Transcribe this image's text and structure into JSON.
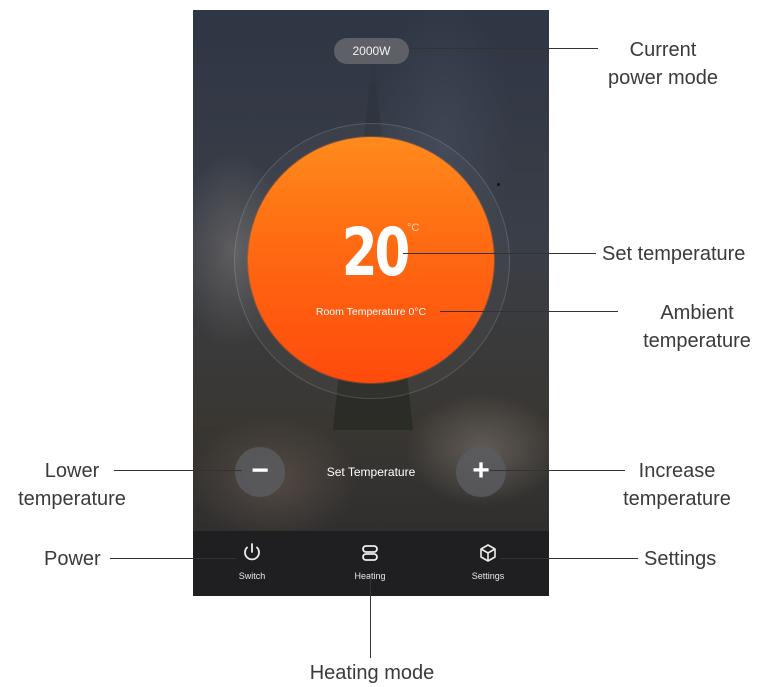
{
  "screen": {
    "power_mode": "2000W",
    "set_temperature": "20",
    "unit": "°C",
    "room_temperature": "Room Temperature 0°C",
    "minus_symbol": "−",
    "plus_symbol": "+",
    "set_label": "Set Temperature"
  },
  "tabs": [
    {
      "label": "Switch",
      "icon": "power-icon"
    },
    {
      "label": "Heating",
      "icon": "heating-mode-icon"
    },
    {
      "label": "Settings",
      "icon": "settings-cube-icon"
    }
  ],
  "annotations": {
    "current_power_mode": [
      "Current",
      "power mode"
    ],
    "set_temperature": "Set temperature",
    "ambient_temperature": [
      "Ambient",
      "temperature"
    ],
    "lower_temperature": [
      "Lower",
      "temperature"
    ],
    "increase_temperature": [
      "Increase",
      "temperature"
    ],
    "power": "Power",
    "settings": "Settings",
    "heating_mode": "Heating mode"
  }
}
